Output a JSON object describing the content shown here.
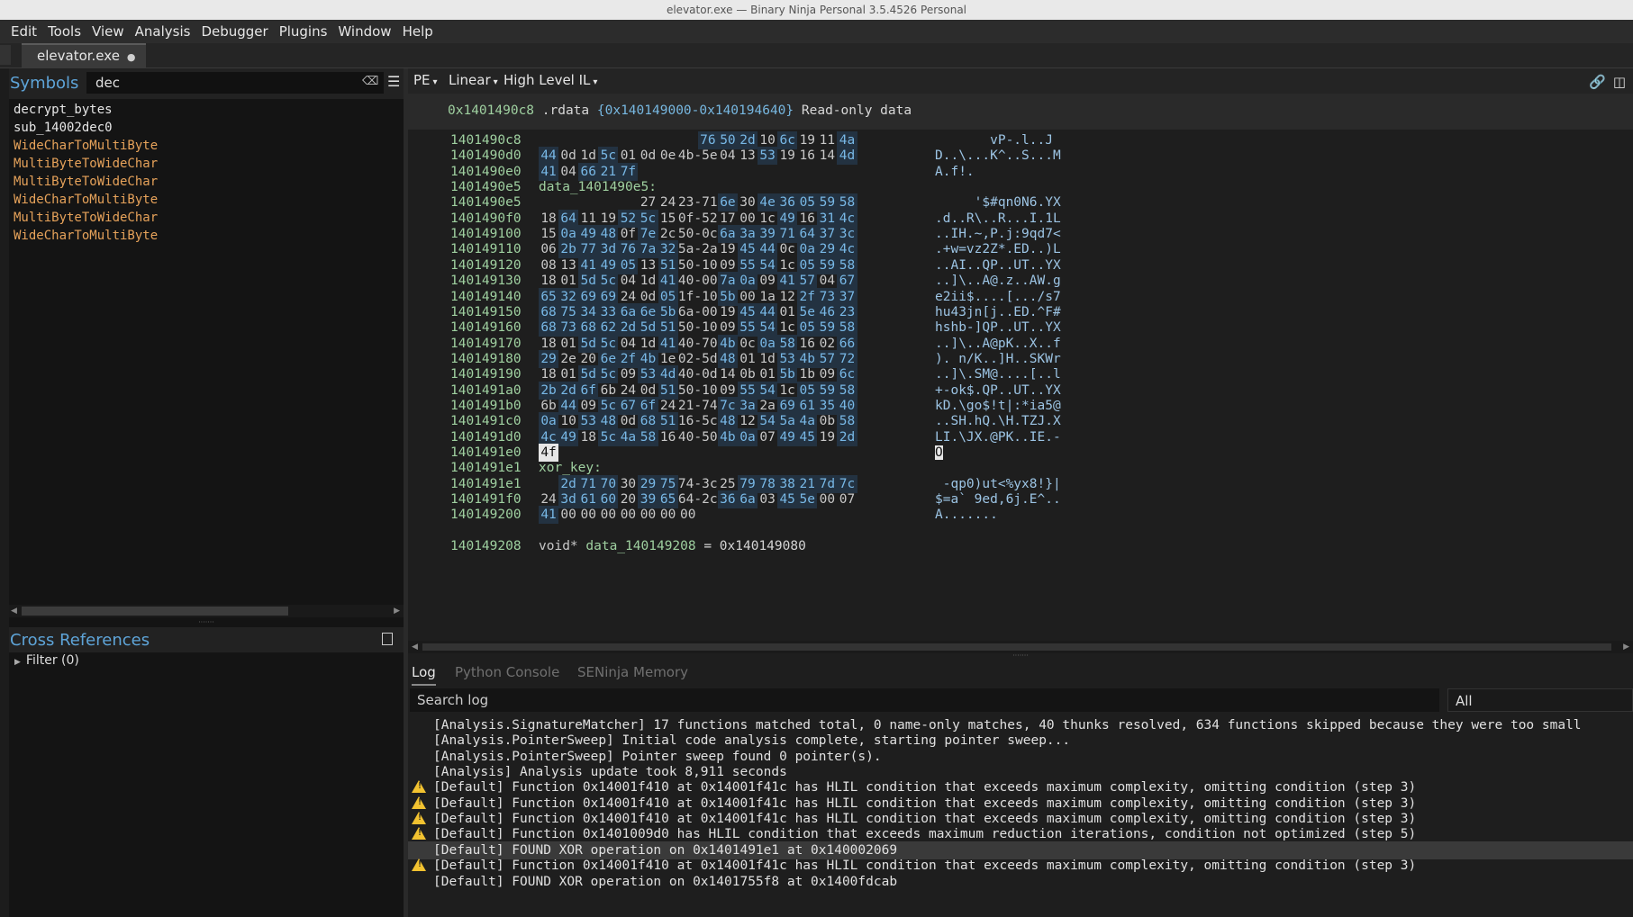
{
  "window_title": "elevator.exe — Binary Ninja Personal 3.5.4526 Personal",
  "menu": [
    "Edit",
    "Tools",
    "View",
    "Analysis",
    "Debugger",
    "Plugins",
    "Window",
    "Help"
  ],
  "tab": {
    "label": "elevator.exe",
    "modified_indicator": "●"
  },
  "symbols": {
    "title": "Symbols",
    "search_value": "dec",
    "clear_icon": "⌫",
    "menu_icon": "☰",
    "items": [
      {
        "name": "decrypt_bytes",
        "color": "white"
      },
      {
        "name": "sub_14002dec0",
        "color": "white"
      },
      {
        "name": "WideCharToMultiByte",
        "color": "orange"
      },
      {
        "name": "MultiByteToWideChar",
        "color": "orange"
      },
      {
        "name": "MultiByteToWideChar",
        "color": "orange"
      },
      {
        "name": "WideCharToMultiByte",
        "color": "orange"
      },
      {
        "name": "MultiByteToWideChar",
        "color": "orange"
      },
      {
        "name": "WideCharToMultiByte",
        "color": "orange"
      }
    ]
  },
  "cross_references": {
    "title": "Cross References",
    "filter_label": "Filter (0)"
  },
  "view_bar": {
    "pe": "PE",
    "linear": "Linear",
    "il": "High Level IL",
    "caret": "▾"
  },
  "section_header": {
    "addr": "0x1401490c8",
    "name": ".rdata",
    "range": "{0x140149000-0x140194640}",
    "desc": "Read-only data"
  },
  "hex_rows": [
    {
      "addr": "1401490c8",
      "offset": 8,
      "bytes": [
        "76",
        "50",
        "2d",
        "10",
        "6c",
        "19",
        "11",
        "4a"
      ],
      "ascii": "       vP-.l..J"
    },
    {
      "addr": "1401490d0",
      "offset": 0,
      "bytes": [
        "44",
        "0d",
        "1d",
        "5c",
        "01",
        "0d",
        "0e",
        "4b-5e",
        "04",
        "13",
        "53",
        "19",
        "16",
        "14",
        "4d"
      ],
      "ascii": "D..\\...K^..S...M"
    },
    {
      "addr": "1401490e0",
      "offset": 0,
      "bytes": [
        "41",
        "04",
        "66",
        "21",
        "7f"
      ],
      "ascii": "A.f!."
    },
    {
      "addr": "1401490e5",
      "label": "data_1401490e5:"
    },
    {
      "addr": "1401490e5",
      "offset": 5,
      "bytes": [
        "27",
        "24",
        "23-71",
        "6e",
        "30",
        "4e",
        "36",
        "05",
        "59",
        "58"
      ],
      "ascii": "     '$#qn0N6.YX"
    },
    {
      "addr": "1401490f0",
      "offset": 0,
      "bytes": [
        "18",
        "64",
        "11",
        "19",
        "52",
        "5c",
        "15",
        "0f-52",
        "17",
        "00",
        "1c",
        "49",
        "16",
        "31",
        "4c"
      ],
      "ascii": ".d..R\\..R...I.1L"
    },
    {
      "addr": "140149100",
      "offset": 0,
      "bytes": [
        "15",
        "0a",
        "49",
        "48",
        "0f",
        "7e",
        "2c",
        "50-0c",
        "6a",
        "3a",
        "39",
        "71",
        "64",
        "37",
        "3c"
      ],
      "ascii": "..IH.~,P.j:9qd7<"
    },
    {
      "addr": "140149110",
      "offset": 0,
      "bytes": [
        "06",
        "2b",
        "77",
        "3d",
        "76",
        "7a",
        "32",
        "5a-2a",
        "19",
        "45",
        "44",
        "0c",
        "0a",
        "29",
        "4c"
      ],
      "ascii": ".+w=vz2Z*.ED..)L"
    },
    {
      "addr": "140149120",
      "offset": 0,
      "bytes": [
        "08",
        "13",
        "41",
        "49",
        "05",
        "13",
        "51",
        "50-10",
        "09",
        "55",
        "54",
        "1c",
        "05",
        "59",
        "58"
      ],
      "ascii": "..AI..QP..UT..YX"
    },
    {
      "addr": "140149130",
      "offset": 0,
      "bytes": [
        "18",
        "01",
        "5d",
        "5c",
        "04",
        "1d",
        "41",
        "40-00",
        "7a",
        "0a",
        "09",
        "41",
        "57",
        "04",
        "67"
      ],
      "ascii": "..]\\..A@.z..AW.g"
    },
    {
      "addr": "140149140",
      "offset": 0,
      "bytes": [
        "65",
        "32",
        "69",
        "69",
        "24",
        "0d",
        "05",
        "1f-10",
        "5b",
        "00",
        "1a",
        "12",
        "2f",
        "73",
        "37"
      ],
      "ascii": "e2ii$....[.../s7"
    },
    {
      "addr": "140149150",
      "offset": 0,
      "bytes": [
        "68",
        "75",
        "34",
        "33",
        "6a",
        "6e",
        "5b",
        "6a-00",
        "19",
        "45",
        "44",
        "01",
        "5e",
        "46",
        "23"
      ],
      "ascii": "hu43jn[j..ED.^F#"
    },
    {
      "addr": "140149160",
      "offset": 0,
      "bytes": [
        "68",
        "73",
        "68",
        "62",
        "2d",
        "5d",
        "51",
        "50-10",
        "09",
        "55",
        "54",
        "1c",
        "05",
        "59",
        "58"
      ],
      "ascii": "hshb-]QP..UT..YX"
    },
    {
      "addr": "140149170",
      "offset": 0,
      "bytes": [
        "18",
        "01",
        "5d",
        "5c",
        "04",
        "1d",
        "41",
        "40-70",
        "4b",
        "0c",
        "0a",
        "58",
        "16",
        "02",
        "66"
      ],
      "ascii": "..]\\..A@pK..X..f"
    },
    {
      "addr": "140149180",
      "offset": 0,
      "bytes": [
        "29",
        "2e",
        "20",
        "6e",
        "2f",
        "4b",
        "1e",
        "02-5d",
        "48",
        "01",
        "1d",
        "53",
        "4b",
        "57",
        "72"
      ],
      "ascii": "). n/K..]H..SKWr"
    },
    {
      "addr": "140149190",
      "offset": 0,
      "bytes": [
        "18",
        "01",
        "5d",
        "5c",
        "09",
        "53",
        "4d",
        "40-0d",
        "14",
        "0b",
        "01",
        "5b",
        "1b",
        "09",
        "6c"
      ],
      "ascii": "..]\\.SM@....[..l"
    },
    {
      "addr": "1401491a0",
      "offset": 0,
      "bytes": [
        "2b",
        "2d",
        "6f",
        "6b",
        "24",
        "0d",
        "51",
        "50-10",
        "09",
        "55",
        "54",
        "1c",
        "05",
        "59",
        "58"
      ],
      "ascii": "+-ok$.QP..UT..YX"
    },
    {
      "addr": "1401491b0",
      "offset": 0,
      "bytes": [
        "6b",
        "44",
        "09",
        "5c",
        "67",
        "6f",
        "24",
        "21-74",
        "7c",
        "3a",
        "2a",
        "69",
        "61",
        "35",
        "40"
      ],
      "ascii": "kD.\\go$!t|:*ia5@"
    },
    {
      "addr": "1401491c0",
      "offset": 0,
      "bytes": [
        "0a",
        "10",
        "53",
        "48",
        "0d",
        "68",
        "51",
        "16-5c",
        "48",
        "12",
        "54",
        "5a",
        "4a",
        "0b",
        "58"
      ],
      "ascii": "..SH.hQ.\\H.TZJ.X"
    },
    {
      "addr": "1401491d0",
      "offset": 0,
      "bytes": [
        "4c",
        "49",
        "18",
        "5c",
        "4a",
        "58",
        "16",
        "40-50",
        "4b",
        "0a",
        "07",
        "49",
        "45",
        "19",
        "2d"
      ],
      "ascii": "LI.\\JX.@PK..IE.-"
    },
    {
      "addr": "1401491e0",
      "offset": 0,
      "bytes": [
        "4f"
      ],
      "ascii": "O",
      "selected": true
    },
    {
      "addr": "1401491e1",
      "label": "xor_key:"
    },
    {
      "addr": "1401491e1",
      "offset": 1,
      "bytes": [
        "2d",
        "71",
        "70",
        "30",
        "29",
        "75",
        "74-3c",
        "25",
        "79",
        "78",
        "38",
        "21",
        "7d",
        "7c"
      ],
      "ascii": " -qp0)ut<%yx8!}|"
    },
    {
      "addr": "1401491f0",
      "offset": 0,
      "bytes": [
        "24",
        "3d",
        "61",
        "60",
        "20",
        "39",
        "65",
        "64-2c",
        "36",
        "6a",
        "03",
        "45",
        "5e",
        "00",
        "07"
      ],
      "ascii": "$=a` 9ed,6j.E^.."
    },
    {
      "addr": "140149200",
      "offset": 0,
      "bytes": [
        "41",
        "00",
        "00",
        "00",
        "00",
        "00",
        "00",
        "00"
      ],
      "ascii": "A......."
    },
    {
      "addr": "",
      "blank": true
    },
    {
      "addr": "140149208",
      "decl": {
        "type": "void*",
        "name": "data_140149208",
        "value": "= 0x140149080"
      }
    }
  ],
  "log_tabs": [
    "Log",
    "Python Console",
    "SENinja Memory"
  ],
  "log_search_placeholder": "Search log",
  "log_filter": "All",
  "log_lines": [
    {
      "warn": false,
      "text": "[Analysis.SignatureMatcher] 17 functions matched total, 0 name-only matches, 40 thunks resolved, 634 functions skipped because they were too small"
    },
    {
      "warn": false,
      "text": "[Analysis.PointerSweep] Initial code analysis complete, starting pointer sweep..."
    },
    {
      "warn": false,
      "text": "[Analysis.PointerSweep] Pointer sweep found 0 pointer(s)."
    },
    {
      "warn": false,
      "text": "[Analysis] Analysis update took 8,911 seconds"
    },
    {
      "warn": true,
      "text": "[Default] Function 0x14001f410 at 0x14001f41c has HLIL condition that exceeds maximum complexity, omitting condition (step 3)"
    },
    {
      "warn": true,
      "text": "[Default] Function 0x14001f410 at 0x14001f41c has HLIL condition that exceeds maximum complexity, omitting condition (step 3)"
    },
    {
      "warn": true,
      "text": "[Default] Function 0x14001f410 at 0x14001f41c has HLIL condition that exceeds maximum complexity, omitting condition (step 3)"
    },
    {
      "warn": true,
      "text": "[Default] Function 0x1401009d0 has HLIL condition that exceeds maximum reduction iterations, condition not optimized (step 5)"
    },
    {
      "warn": false,
      "highlight": true,
      "text": "[Default] FOUND XOR operation on 0x1401491e1 at 0x140002069"
    },
    {
      "warn": true,
      "text": "[Default] Function 0x14001f410 at 0x14001f41c has HLIL condition that exceeds maximum complexity, omitting condition (step 3)"
    },
    {
      "warn": false,
      "text": "[Default] FOUND XOR operation on 0x1401755f8 at 0x1400fdcab"
    }
  ],
  "colors": {
    "accent_blue": "#5ea4d8",
    "address_green": "#9fd0a0",
    "import_orange": "#e6a25a",
    "warning_yellow": "#f2c230"
  }
}
